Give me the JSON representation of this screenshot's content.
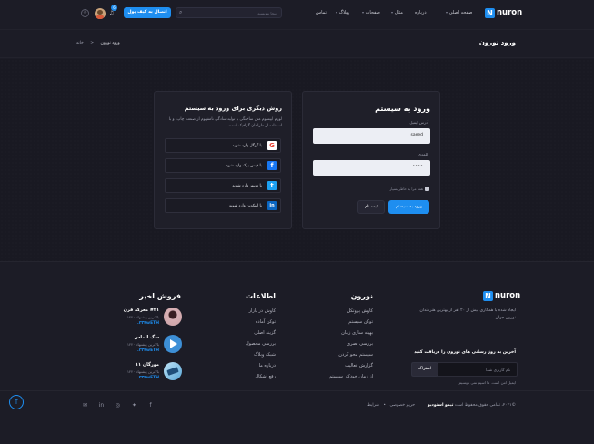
{
  "header": {
    "logo_text": "nuron",
    "logo_mark": "N",
    "nav": [
      "صفحه اصلی",
      "درباره",
      "مثال",
      "صفحات",
      "وبلاگ",
      "تماس"
    ],
    "search_placeholder": "اینجا بنویسید",
    "connect_wallet": "اتصال به کیف پول",
    "notification_count": "6"
  },
  "titlebar": {
    "page_title": "ورود نورون",
    "breadcrumb_home": "خانه",
    "breadcrumb_sep": "<",
    "breadcrumb_current": "ورود نورون"
  },
  "login": {
    "title": "ورود به سیستم",
    "email_label": "آدرس ایمیل",
    "email_value": "saeed",
    "password_label": "کلمه‌ی",
    "password_value": "••••",
    "remember": "همه مرا به خاطر بسپار",
    "login_button": "ورود به سیستم",
    "register_button": "ثبت نام"
  },
  "other_login": {
    "title": "روش دیگری برای ورود به سیستم",
    "desc": "لورم ایپسوم متن ساختگی با تولید سادگی نامفهوم از صنعت چاپ، و با استفاده از طراحان گرافیک است.",
    "buttons": [
      {
        "label": "با گوگل وارد شوید",
        "icon": "google-icon",
        "symbol": "G",
        "color": "#ffffff"
      },
      {
        "label": "با فیس بوک وارد شوید",
        "icon": "facebook-icon",
        "symbol": "f",
        "color": "#1877f2"
      },
      {
        "label": "با توییتر وارد شوید",
        "icon": "twitter-icon",
        "symbol": "t",
        "color": "#1da1f2"
      },
      {
        "label": "با لینکدین وارد شوید",
        "icon": "linkedin-icon",
        "symbol": "in",
        "color": "#0a66c2"
      }
    ]
  },
  "footer": {
    "about_logo": "nuron",
    "about_text": "ایجاد شده با همکاری بیش از ۲۰ نفر از بهترین هنرمندان نورون جهان.",
    "newsletter_title": "آخرین به روز رسانی های نورون را دریافت کنید",
    "newsletter_placeholder": "نام کاربری شما",
    "subscribe_button": "اشتراک",
    "newsletter_note": "ایمیل امن است. ما اسپم نمی نویسیم",
    "col1_title": "نورون",
    "col1_links": [
      "کاوش پروتکل",
      "توکن سیستم",
      "بهینه سازی زمان",
      "بررسی بصری",
      "سیستم محو کردن",
      "گزارش فعالیت",
      "از زمان خودکار سیستم"
    ],
    "col2_title": "اطلاعات",
    "col2_links": [
      "کاوش در بازار",
      "توکن آماده",
      "گزینه اصلی",
      "بررسی محصول",
      "شبکه وبلاگ",
      "درباره ما",
      "رفع اشکال"
    ],
    "col3_title": "فروش اخیر",
    "sales": [
      {
        "name": "#۲۱ معرکه قرن",
        "sub": "بالاترین پیشنهاد ۱۲۲۰",
        "price": "۰.۲۳۴wETH"
      },
      {
        "name": "سگ الماس",
        "sub": "بالاترین پیشنهاد ۱۲۲۰",
        "price": "۰.۲۳۴wETH"
      },
      {
        "name": "مورگان ۱۱",
        "sub": "بالاترین پیشنهاد ۱۲۲۰",
        "price": "۰.۲۳۴wETH"
      }
    ],
    "copyright_prefix": "©۲۰۲۱، تمامی حقوق محفوظ است",
    "copyright_brand": "تیمو استودیو",
    "policy_links": [
      "شرایط",
      "حریم خصوصی"
    ]
  },
  "colors": {
    "accent": "#1e8ef0",
    "bg": "#1c1c26"
  }
}
